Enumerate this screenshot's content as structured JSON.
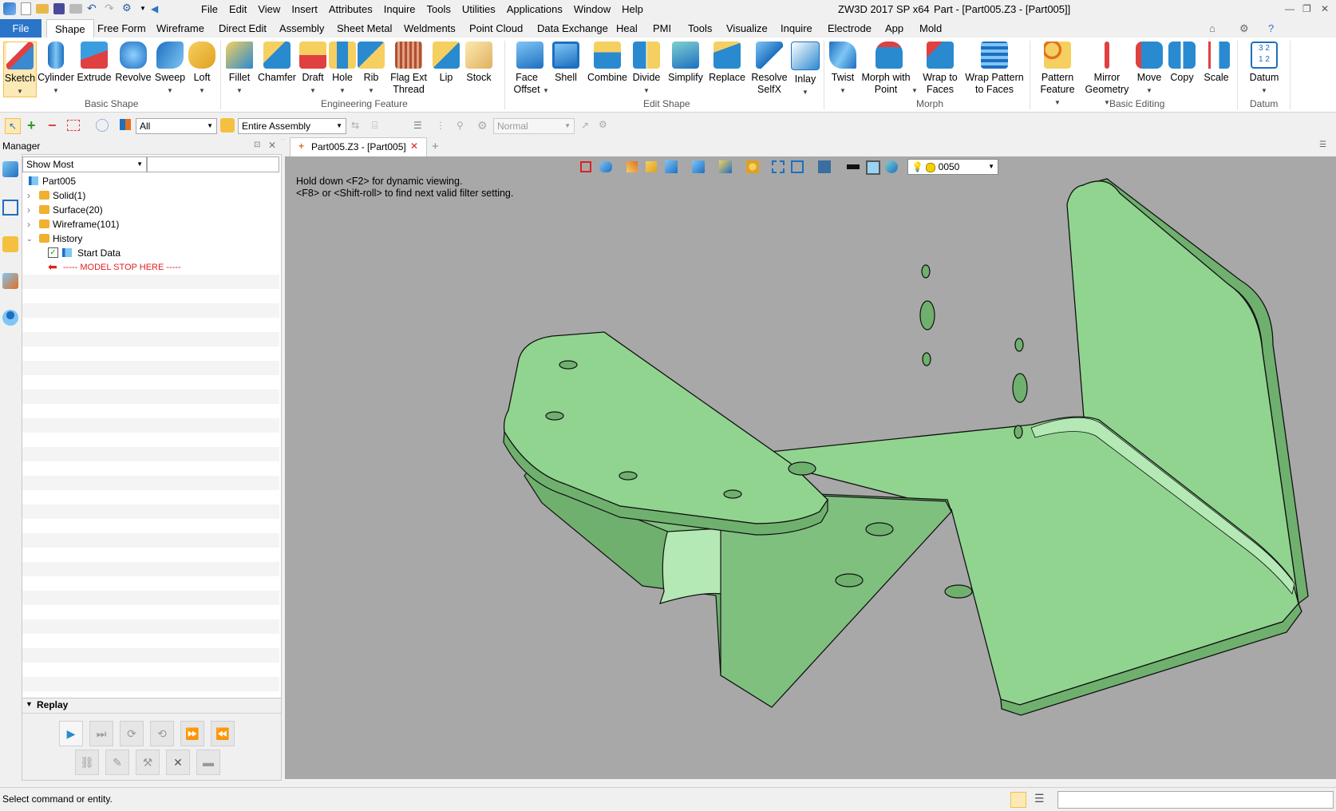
{
  "window": {
    "app_title": "ZW3D 2017 SP x64",
    "doc_title": "Part - [Part005.Z3 - [Part005]]"
  },
  "menu": [
    "File",
    "Edit",
    "View",
    "Insert",
    "Attributes",
    "Inquire",
    "Tools",
    "Utilities",
    "Applications",
    "Window",
    "Help"
  ],
  "ribbon_tabs": {
    "file": "File",
    "active": "Shape",
    "others": [
      "Free Form",
      "Wireframe",
      "Direct Edit",
      "Assembly",
      "Sheet Metal",
      "Weldments",
      "Point Cloud",
      "Data Exchange",
      "Heal",
      "PMI",
      "Tools",
      "Visualize",
      "Inquire",
      "Electrode",
      "App",
      "Mold"
    ]
  },
  "ribbon": {
    "basic_shape": {
      "label": "Basic Shape",
      "buttons": [
        "Sketch",
        "Cylinder",
        "Extrude",
        "Revolve",
        "Sweep",
        "Loft"
      ]
    },
    "engineering_feature": {
      "label": "Engineering Feature",
      "buttons": [
        "Fillet",
        "Chamfer",
        "Draft",
        "Hole",
        "Rib",
        "Flag Ext Thread",
        "Lip",
        "Stock"
      ]
    },
    "edit_shape": {
      "label": "Edit Shape",
      "buttons": [
        "Face Offset",
        "Shell",
        "Combine",
        "Divide",
        "Simplify",
        "Replace",
        "Resolve SelfX",
        "Inlay"
      ]
    },
    "morph": {
      "label": "Morph",
      "buttons": [
        "Twist",
        "Morph with Point",
        "Wrap to Faces",
        "Wrap Pattern to Faces"
      ]
    },
    "basic_editing": {
      "label": "Basic Editing",
      "buttons": [
        "Pattern Feature",
        "Mirror Geometry",
        "Move",
        "Copy",
        "Scale"
      ]
    },
    "datum": {
      "label": "Datum",
      "buttons": [
        "Datum"
      ]
    }
  },
  "toolbar": {
    "filter": "All",
    "scope": "Entire Assembly",
    "mode": "Normal"
  },
  "manager": {
    "title": "Manager",
    "show": "Show Most",
    "search": "",
    "tree": [
      {
        "label": "Part005",
        "level": 0
      },
      {
        "label": "Solid(1)",
        "level": 1
      },
      {
        "label": "Surface(20)",
        "level": 1
      },
      {
        "label": "Wireframe(101)",
        "level": 1
      },
      {
        "label": "History",
        "level": 1
      },
      {
        "label": "Start Data",
        "level": 2
      },
      {
        "label": "----- MODEL STOP HERE -----",
        "level": 2
      }
    ]
  },
  "replay": {
    "title": "Replay"
  },
  "document_tab": "Part005.Z3 - [Part005]",
  "viewport": {
    "hint1": "Hold down <F2> for dynamic viewing.",
    "hint2": "<F8> or <Shift-roll> to find next valid filter setting.",
    "layer": "0050"
  },
  "status": {
    "message": "Select command or entity."
  },
  "colors": {
    "accent": "#2a74c9",
    "viewport_bg": "#a8a8a8",
    "part_face": "#90d490",
    "part_shadow": "#6fb06f",
    "model_stop": "#e02020"
  }
}
